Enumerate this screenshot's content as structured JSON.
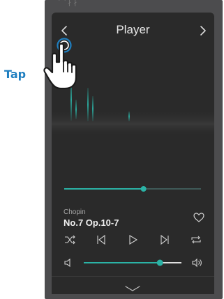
{
  "device": {
    "top_glyphs": "⌒  ∤  ∤"
  },
  "header": {
    "title": "Player",
    "back_icon": "chevron-left-icon",
    "forward_icon": "chevron-right-icon"
  },
  "playback": {
    "progress": 0.58,
    "artist": "Chopin",
    "song": "No.7 Op.10-7",
    "favorite_icon": "heart-icon"
  },
  "controls": {
    "shuffle_icon": "shuffle-icon",
    "previous_icon": "previous-track-icon",
    "play_icon": "play-icon",
    "next_icon": "next-track-icon",
    "repeat_icon": "repeat-icon"
  },
  "volume": {
    "level": 0.78,
    "mute_icon": "speaker-low-icon",
    "loud_icon": "speaker-high-icon"
  },
  "footer": {
    "collapse_icon": "chevron-down-icon"
  },
  "annotation": {
    "label": "Tap"
  },
  "colors": {
    "accent": "#2bb3a6",
    "screen_bg": "#2a2a2a",
    "device_bg": "#4c4c4e",
    "tap_blue": "#1f7fc0"
  }
}
